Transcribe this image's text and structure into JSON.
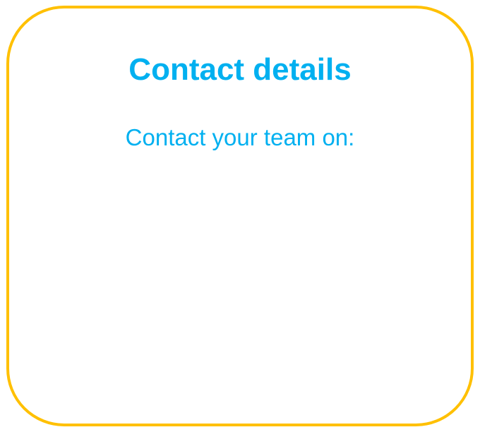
{
  "card": {
    "title": "Contact details",
    "subtitle": "Contact your team on:"
  },
  "colors": {
    "border": "#FFC000",
    "text": "#00B0F0",
    "background": "#FFFFFF"
  }
}
